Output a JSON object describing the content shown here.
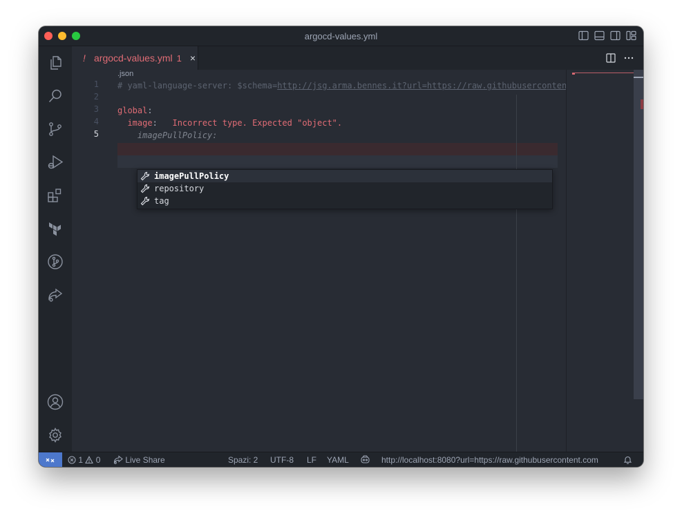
{
  "window": {
    "title": "argocd-values.yml"
  },
  "tab": {
    "icon_glyph": "!",
    "filename": "argocd-values.yml",
    "problem_count": "1",
    "close_glyph": "×"
  },
  "editor": {
    "breadcrumb": ".json",
    "line_numbers": [
      "1",
      "2",
      "3",
      "4",
      "5"
    ],
    "lines": {
      "l1_prefix": "# yaml-language-server: $schema=",
      "l1_url": "http://jsg.arma.bennes.it?url=https://raw.githubuserconten",
      "l3_key": "global",
      "l3_colon": ":",
      "l4_indent": "  ",
      "l4_key": "image",
      "l4_colon": ":",
      "l4_error": "   Incorrect type. Expected \"object\".",
      "l5_ghost": "    imagePullPolicy:"
    }
  },
  "suggestions": [
    {
      "label": "imagePullPolicy",
      "icon": "wrench-icon",
      "selected": true
    },
    {
      "label": "repository",
      "icon": "wrench-icon",
      "selected": false
    },
    {
      "label": "tag",
      "icon": "wrench-icon",
      "selected": false
    }
  ],
  "statusbar": {
    "errors": "1",
    "warnings": "0",
    "live_share": "Live Share",
    "indent": "Spazi: 2",
    "encoding": "UTF-8",
    "eol": "LF",
    "language": "YAML",
    "url": "http://localhost:8080?url=https://raw.githubusercontent.com"
  },
  "colors": {
    "accent": "#4d78cc",
    "error": "#e06c75",
    "background": "#282c34",
    "sidebar": "#21252b"
  }
}
